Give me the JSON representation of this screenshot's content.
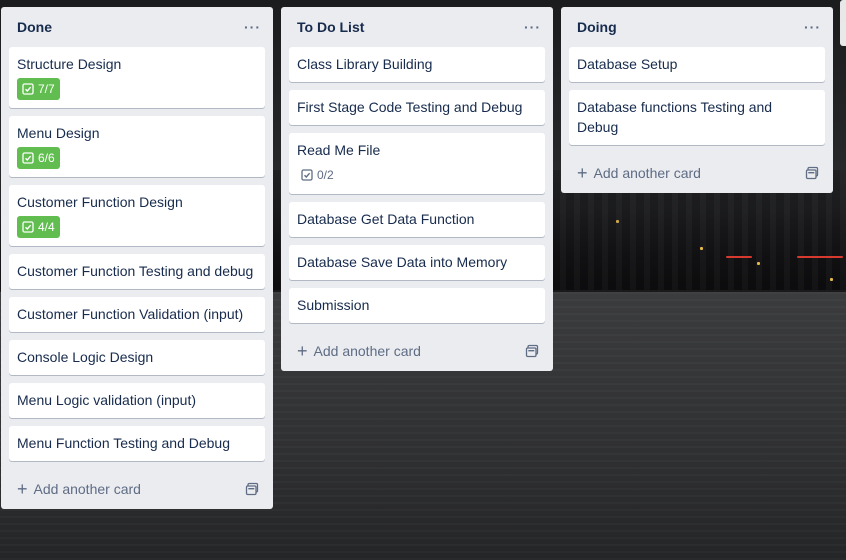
{
  "lists": [
    {
      "title": "Done",
      "menu": "···",
      "cards": [
        {
          "title": "Structure Design",
          "badge": "7/7"
        },
        {
          "title": "Menu Design",
          "badge": "6/6"
        },
        {
          "title": "Customer Function Design",
          "badge": "4/4"
        },
        {
          "title": "Customer Function Testing and debug"
        },
        {
          "title": "Customer Function Validation (input)"
        },
        {
          "title": "Console Logic Design"
        },
        {
          "title": "Menu Logic validation (input)"
        },
        {
          "title": "Menu Function Testing and Debug"
        }
      ],
      "add_label": "Add another card"
    },
    {
      "title": "To Do List",
      "menu": "···",
      "cards": [
        {
          "title": "Class Library Building"
        },
        {
          "title": "First Stage Code Testing and Debug"
        },
        {
          "title": "Read Me File",
          "badge": "0/2"
        },
        {
          "title": "Database Get Data Function"
        },
        {
          "title": "Database Save Data into Memory"
        },
        {
          "title": "Submission"
        }
      ],
      "add_label": "Add another card"
    },
    {
      "title": "Doing",
      "menu": "···",
      "cards": [
        {
          "title": "Database Setup"
        },
        {
          "title": "Database functions Testing and Debug"
        }
      ],
      "add_label": "Add another card"
    }
  ],
  "icons": {
    "checklist": "checklist-icon",
    "add": "plus-icon",
    "template": "card-template-icon",
    "menu": "more-horizontal-icon"
  },
  "colors": {
    "list_bg": "#ebecf0",
    "badge_complete": "#61bd4f",
    "text": "#172b4d",
    "muted": "#5e6c84"
  }
}
